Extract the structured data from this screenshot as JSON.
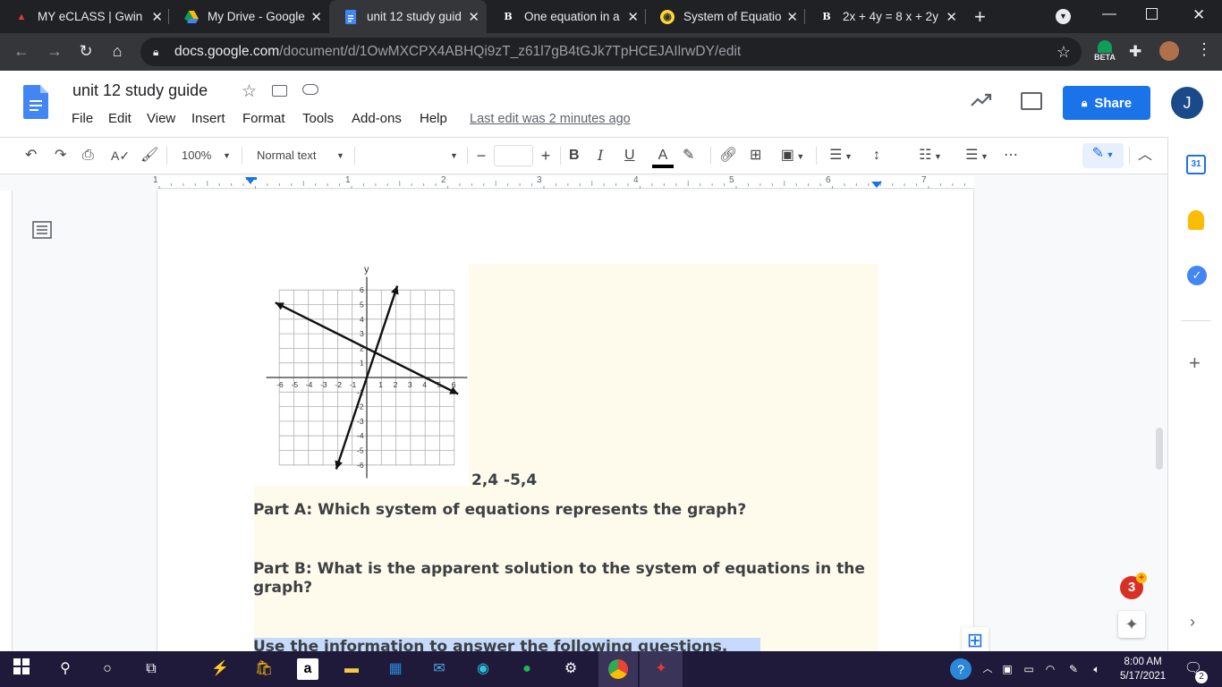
{
  "browser": {
    "tabs": [
      {
        "title": "MY eCLASS | Gwin",
        "icon": "eclass-icon"
      },
      {
        "title": "My Drive - Google",
        "icon": "drive-icon"
      },
      {
        "title": "unit 12 study guid",
        "icon": "docs-icon"
      },
      {
        "title": "One equation in a",
        "icon": "brainly-icon"
      },
      {
        "title": "System of Equatio",
        "icon": "owl-icon"
      },
      {
        "title": "2x + 4y = 8 x + 2y",
        "icon": "brainly-icon"
      }
    ],
    "url_domain": "docs.google.com",
    "url_path": "/document/d/1OwMXCPX4ABHQi9zT_z61l7gB4tGJk7TpHCEJAIlrwDY/edit",
    "profile_badge": "BETA"
  },
  "doc": {
    "title": "unit 12 study guide",
    "menu": [
      "File",
      "Edit",
      "View",
      "Insert",
      "Format",
      "Tools",
      "Add-ons",
      "Help"
    ],
    "last_edit": "Last edit was 2 minutes ago",
    "share_label": "Share",
    "avatar_initial": "J"
  },
  "toolbar": {
    "zoom": "100%",
    "style": "Normal text",
    "font": "",
    "font_size": ""
  },
  "ruler": {
    "numbers": [
      "1",
      "1",
      "2",
      "3",
      "4",
      "5",
      "6",
      "7"
    ]
  },
  "graph": {
    "x_ticks": [
      "-6",
      "-5",
      "-4",
      "-3",
      "-2",
      "-1",
      "1",
      "2",
      "3",
      "4",
      "5",
      "6"
    ],
    "y_ticks": [
      "6",
      "5",
      "4",
      "3",
      "2",
      "1",
      "-1",
      "-2",
      "-3",
      "-4",
      "-5",
      "-6"
    ],
    "x_label": "x",
    "y_label": "y",
    "lines": [
      {
        "p1": [
          -6,
          5
        ],
        "p2": [
          6,
          -1
        ]
      },
      {
        "p1": [
          -2,
          -6
        ],
        "p2": [
          2,
          6
        ]
      }
    ]
  },
  "content": {
    "answer_note": "2,4  -5,4",
    "part_a": "Part A: Which system of equations represents the graph?",
    "part_b": "Part B: What is the apparent solution to the system of equations in the graph?",
    "next_heading": "Use the information to answer the following questions."
  },
  "notifications": {
    "count": "3"
  },
  "taskbar": {
    "time": "8:00 AM",
    "date": "5/17/2021",
    "notif_count": "2"
  },
  "colors": {
    "accent": "#1a73e8",
    "cream": "#fffbec",
    "selection": "#c6dafc"
  }
}
